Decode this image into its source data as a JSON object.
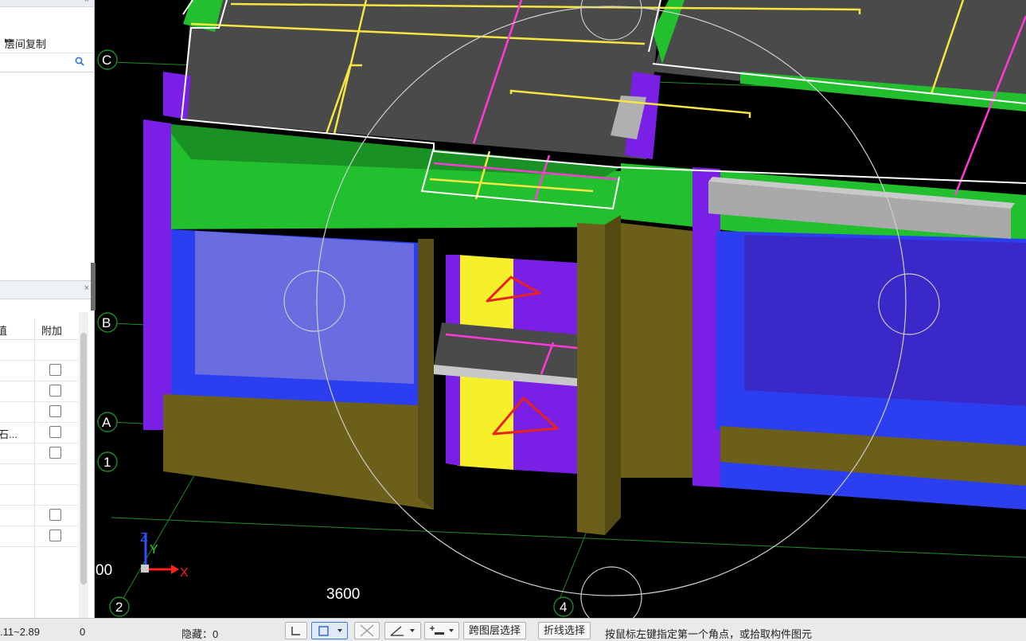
{
  "left_panel": {
    "copy_label": "层间复制",
    "more_glyph": "▸▸",
    "search_icon": "search-icon",
    "close_glyph": "×",
    "props": {
      "col_value": "值",
      "col_add": "附加",
      "rows": [
        {
          "text": "",
          "checkbox": false
        },
        {
          "text": "",
          "checkbox": true
        },
        {
          "text": "",
          "checkbox": true
        },
        {
          "text": "",
          "checkbox": true
        },
        {
          "text": "石...",
          "checkbox": true
        },
        {
          "text": "",
          "checkbox": true
        },
        {
          "text": "",
          "checkbox": false
        },
        {
          "text": "",
          "checkbox": false
        },
        {
          "text": "",
          "checkbox": true
        },
        {
          "text": "",
          "checkbox": true
        }
      ]
    }
  },
  "viewport": {
    "axis_labels": [
      "C",
      "B",
      "A",
      "1",
      "2",
      "4"
    ],
    "dimension_text": "3600",
    "partial_text_left": "00",
    "axis_x": "X",
    "axis_y": "Y",
    "axis_z": "Z"
  },
  "status_bar": {
    "range": ".11~2.89",
    "zero": "0",
    "hidden": "隐藏：0",
    "cross_layer_select": "跨图层选择",
    "polyline_select": "折线选择",
    "hint": "按鼠标左键指定第一个角点，或拾取构件图元"
  },
  "colors": {
    "wall_green": "#22c02e",
    "column_purple": "#7a1fe6",
    "window_blue": "#2b3ff0",
    "olive": "#6b5f1a",
    "slab_dark": "#4a4a4a",
    "yellow_line": "#f5e642",
    "magenta_line": "#ff3ad8",
    "red_annotation": "#e8231b"
  }
}
